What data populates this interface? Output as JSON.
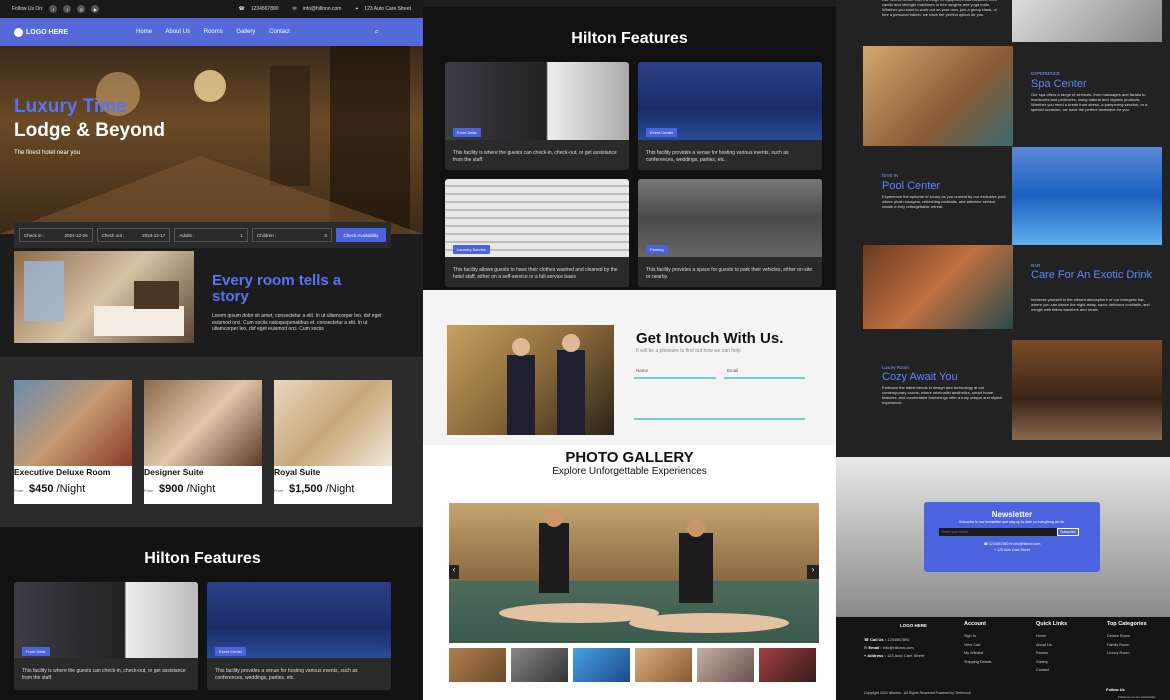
{
  "topbar": {
    "follow": "Follow Us On:",
    "phone": "1234567890",
    "email": "info@hiltonn.com",
    "address": "123 Auto Care Street"
  },
  "nav": {
    "logo": "LOGO HERE",
    "items": [
      "Home",
      "About Us",
      "Rooms",
      "Gallery",
      "Contact"
    ]
  },
  "hero": {
    "title1": "Luxury Time",
    "title2": "Lodge & Beyond",
    "subtitle": "The finest hotel near you"
  },
  "booking": {
    "checkin_label": "Check in :",
    "checkin": "2024-12-16",
    "checkout_label": "Check out :",
    "checkout": "2024-12-17",
    "adults_label": "Adults :",
    "adults": "1",
    "children_label": "Children :",
    "children": "0",
    "button": "Check Availability"
  },
  "story": {
    "title1": "Every room tells a",
    "title2": "story",
    "text": "Lorem ipsum dolor sit amet, consectetur a elit. In ut ullamcorper leo, dsf eget euismod orci. Cum sociis natoquepenatibus et. consectetur a elit. In ut ullamcorper leo, dsf eget euismod orci. Cum sociis"
  },
  "rooms": [
    {
      "name": "Executive Deluxe Room",
      "from": "From",
      "price": "$450",
      "unit": "/Night"
    },
    {
      "name": "Designer Suite",
      "from": "From",
      "price": "$900",
      "unit": "/Night"
    },
    {
      "name": "Royal Suite",
      "from": "From",
      "price": "$1,500",
      "unit": "/Night"
    }
  ],
  "features": {
    "title": "Hilton Features",
    "items": [
      {
        "tag": "Front Desk",
        "text": "This facility is where the guests can check-in, check-out, or get assistance from the staff."
      },
      {
        "tag": "Event Center",
        "text": "This facility provides a venue for hosting various events, such as conferences, weddings, parties, etc."
      },
      {
        "tag": "Laundry Service",
        "text": "This facility allows guests to have their clothes washed and cleaned by the hotel staff, either on a self-service or a full-service basis"
      },
      {
        "tag": "Parking",
        "text": "This facility provides a space for guests to park their vehicles, either on-site or nearby."
      }
    ]
  },
  "contact": {
    "title": "Get Intouch With Us.",
    "subtitle": "It will be a pleasure to find out how we can help",
    "name_label": "Name",
    "email_label": "Email"
  },
  "gallery": {
    "title": "PHOTO GALLERY",
    "subtitle": "Explore Unforgettable Experiences"
  },
  "amenities": [
    {
      "label": "",
      "title": "",
      "text": "Our fitness center offers a range of equipment and facilities, from cardio and strength machines to free weights and yoga mats. Whether you want to work out on your own, join a group class, or hire a personal trainer, we have the perfect option for you."
    },
    {
      "label": "EXPERIENCE",
      "title": "Spa Center",
      "text": "Our spa offers a range of services, from massages and facials to manicures and pedicures, using natural and organic products. Whether you need a break from stress, a pampering session, or a special occasion, we have the perfect treatment for you."
    },
    {
      "label": "DIVE IN",
      "title": "Pool Center",
      "text": "Experience the epitome of luxury as you unwind by our exclusive pool, where plush loungers, refreshing cocktails, and attentive service create a truly unforgettable retreat."
    },
    {
      "label": "BAR",
      "title": "Care For An Exotic Drink",
      "text": "Immerse yourself in the vibrant atmosphere of our energetic bar, where you can dance the night away, savor delicious cocktails, and mingle with fellow travelers and locals."
    },
    {
      "label": "Luxury Room",
      "title": "Cozy Await You",
      "text": "Embrace the latest trends in design and technology at our contemporary rooms, where minimalist aesthetics, smart home features, and comfortable furnishings offer a truly unique and stylish experience."
    }
  ],
  "newsletter": {
    "title": "Newsletter",
    "text": "Subscribe to our newsletter and stay up to date on everything we do.",
    "placeholder": "Enter your email",
    "button": "Subscribe",
    "contact1": "1234567890",
    "contact2": "info@hiltonn.com",
    "contact3": "123 Auto Care Street"
  },
  "footer": {
    "logo": "LOGO HERE",
    "call_label": "Call Us :",
    "call": "1234567890",
    "email_label": "Email :",
    "email": "info@hiltonn.com",
    "address_label": "Address :",
    "address": "123 Auto Care Street",
    "cols": [
      {
        "title": "Account",
        "items": [
          "Sign In",
          "View Cart",
          "My Wishlist",
          "Shipping Details"
        ]
      },
      {
        "title": "Quick Links",
        "items": [
          "Home",
          "About Us",
          "Rooms",
          "Gallery",
          "Contact"
        ]
      },
      {
        "title": "Top Categories",
        "items": [
          "Deluxe Room",
          "Family Room",
          "Luxury Room"
        ]
      }
    ],
    "copyright": "Copyright 2024 hiltonnn - All Rights Reserved Powered by Techmock",
    "follow": "Follow Us",
    "follow_sub": "Follow us on our social links"
  },
  "colors": {
    "accent": "#4c63e0",
    "dark": "#1c1c1c"
  }
}
